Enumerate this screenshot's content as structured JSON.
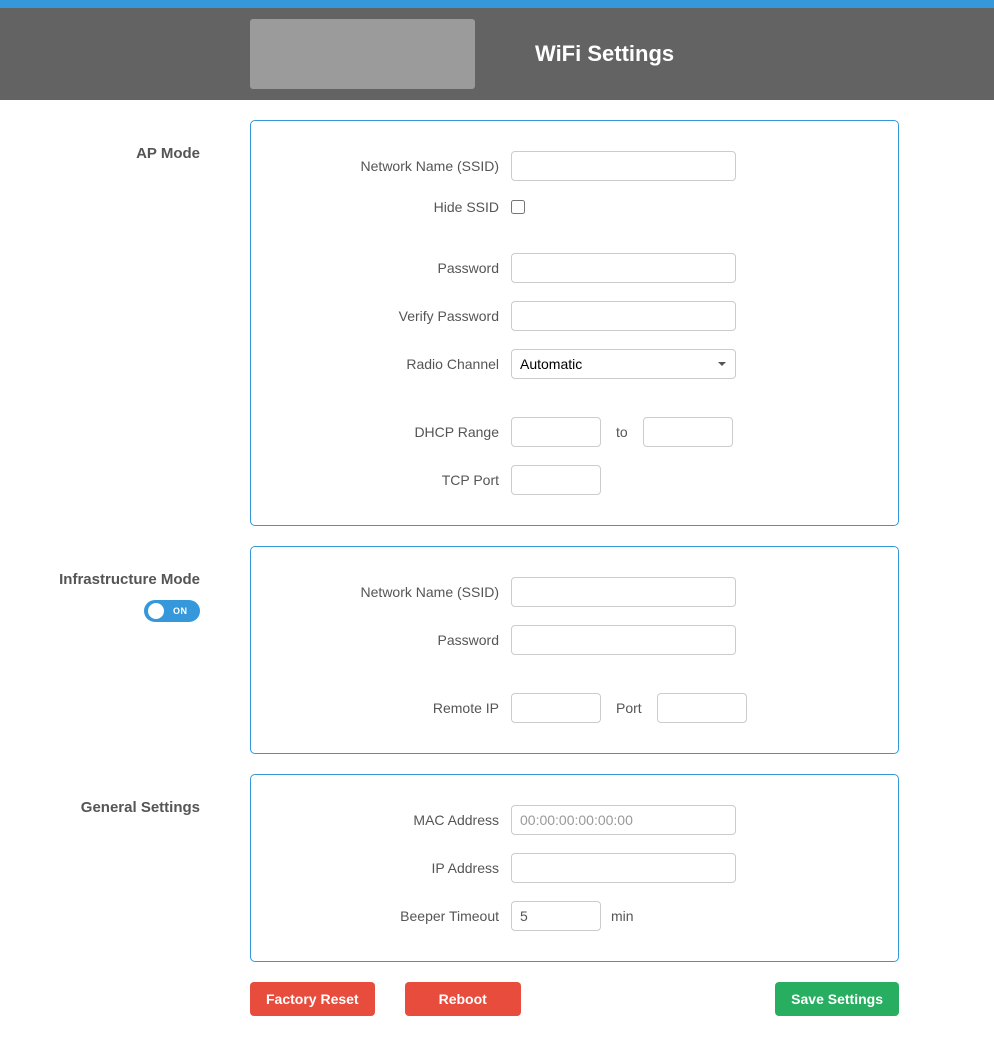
{
  "header": {
    "title": "WiFi Settings"
  },
  "sections": {
    "ap_mode": {
      "title": "AP Mode",
      "labels": {
        "ssid": "Network Name (SSID)",
        "hide_ssid": "Hide SSID",
        "password": "Password",
        "verify_password": "Verify Password",
        "radio_channel": "Radio Channel",
        "dhcp_range": "DHCP Range",
        "dhcp_to": "to",
        "tcp_port": "TCP Port"
      },
      "values": {
        "ssid": "",
        "hide_ssid": false,
        "password": "",
        "verify_password": "",
        "radio_channel": "Automatic",
        "dhcp_from": "",
        "dhcp_to": "",
        "tcp_port": ""
      }
    },
    "infra_mode": {
      "title": "Infrastructure Mode",
      "toggle": {
        "on": true,
        "label": "ON"
      },
      "labels": {
        "ssid": "Network Name (SSID)",
        "password": "Password",
        "remote_ip": "Remote IP",
        "port": "Port"
      },
      "values": {
        "ssid": "",
        "password": "",
        "remote_ip": "",
        "port": ""
      }
    },
    "general": {
      "title": "General Settings",
      "labels": {
        "mac": "MAC Address",
        "ip": "IP Address",
        "beeper": "Beeper Timeout",
        "min": "min"
      },
      "values": {
        "mac_placeholder": "00:00:00:00:00:00",
        "mac": "",
        "ip": "",
        "beeper": "5"
      }
    }
  },
  "buttons": {
    "factory_reset": "Factory Reset",
    "reboot": "Reboot",
    "save": "Save Settings"
  }
}
